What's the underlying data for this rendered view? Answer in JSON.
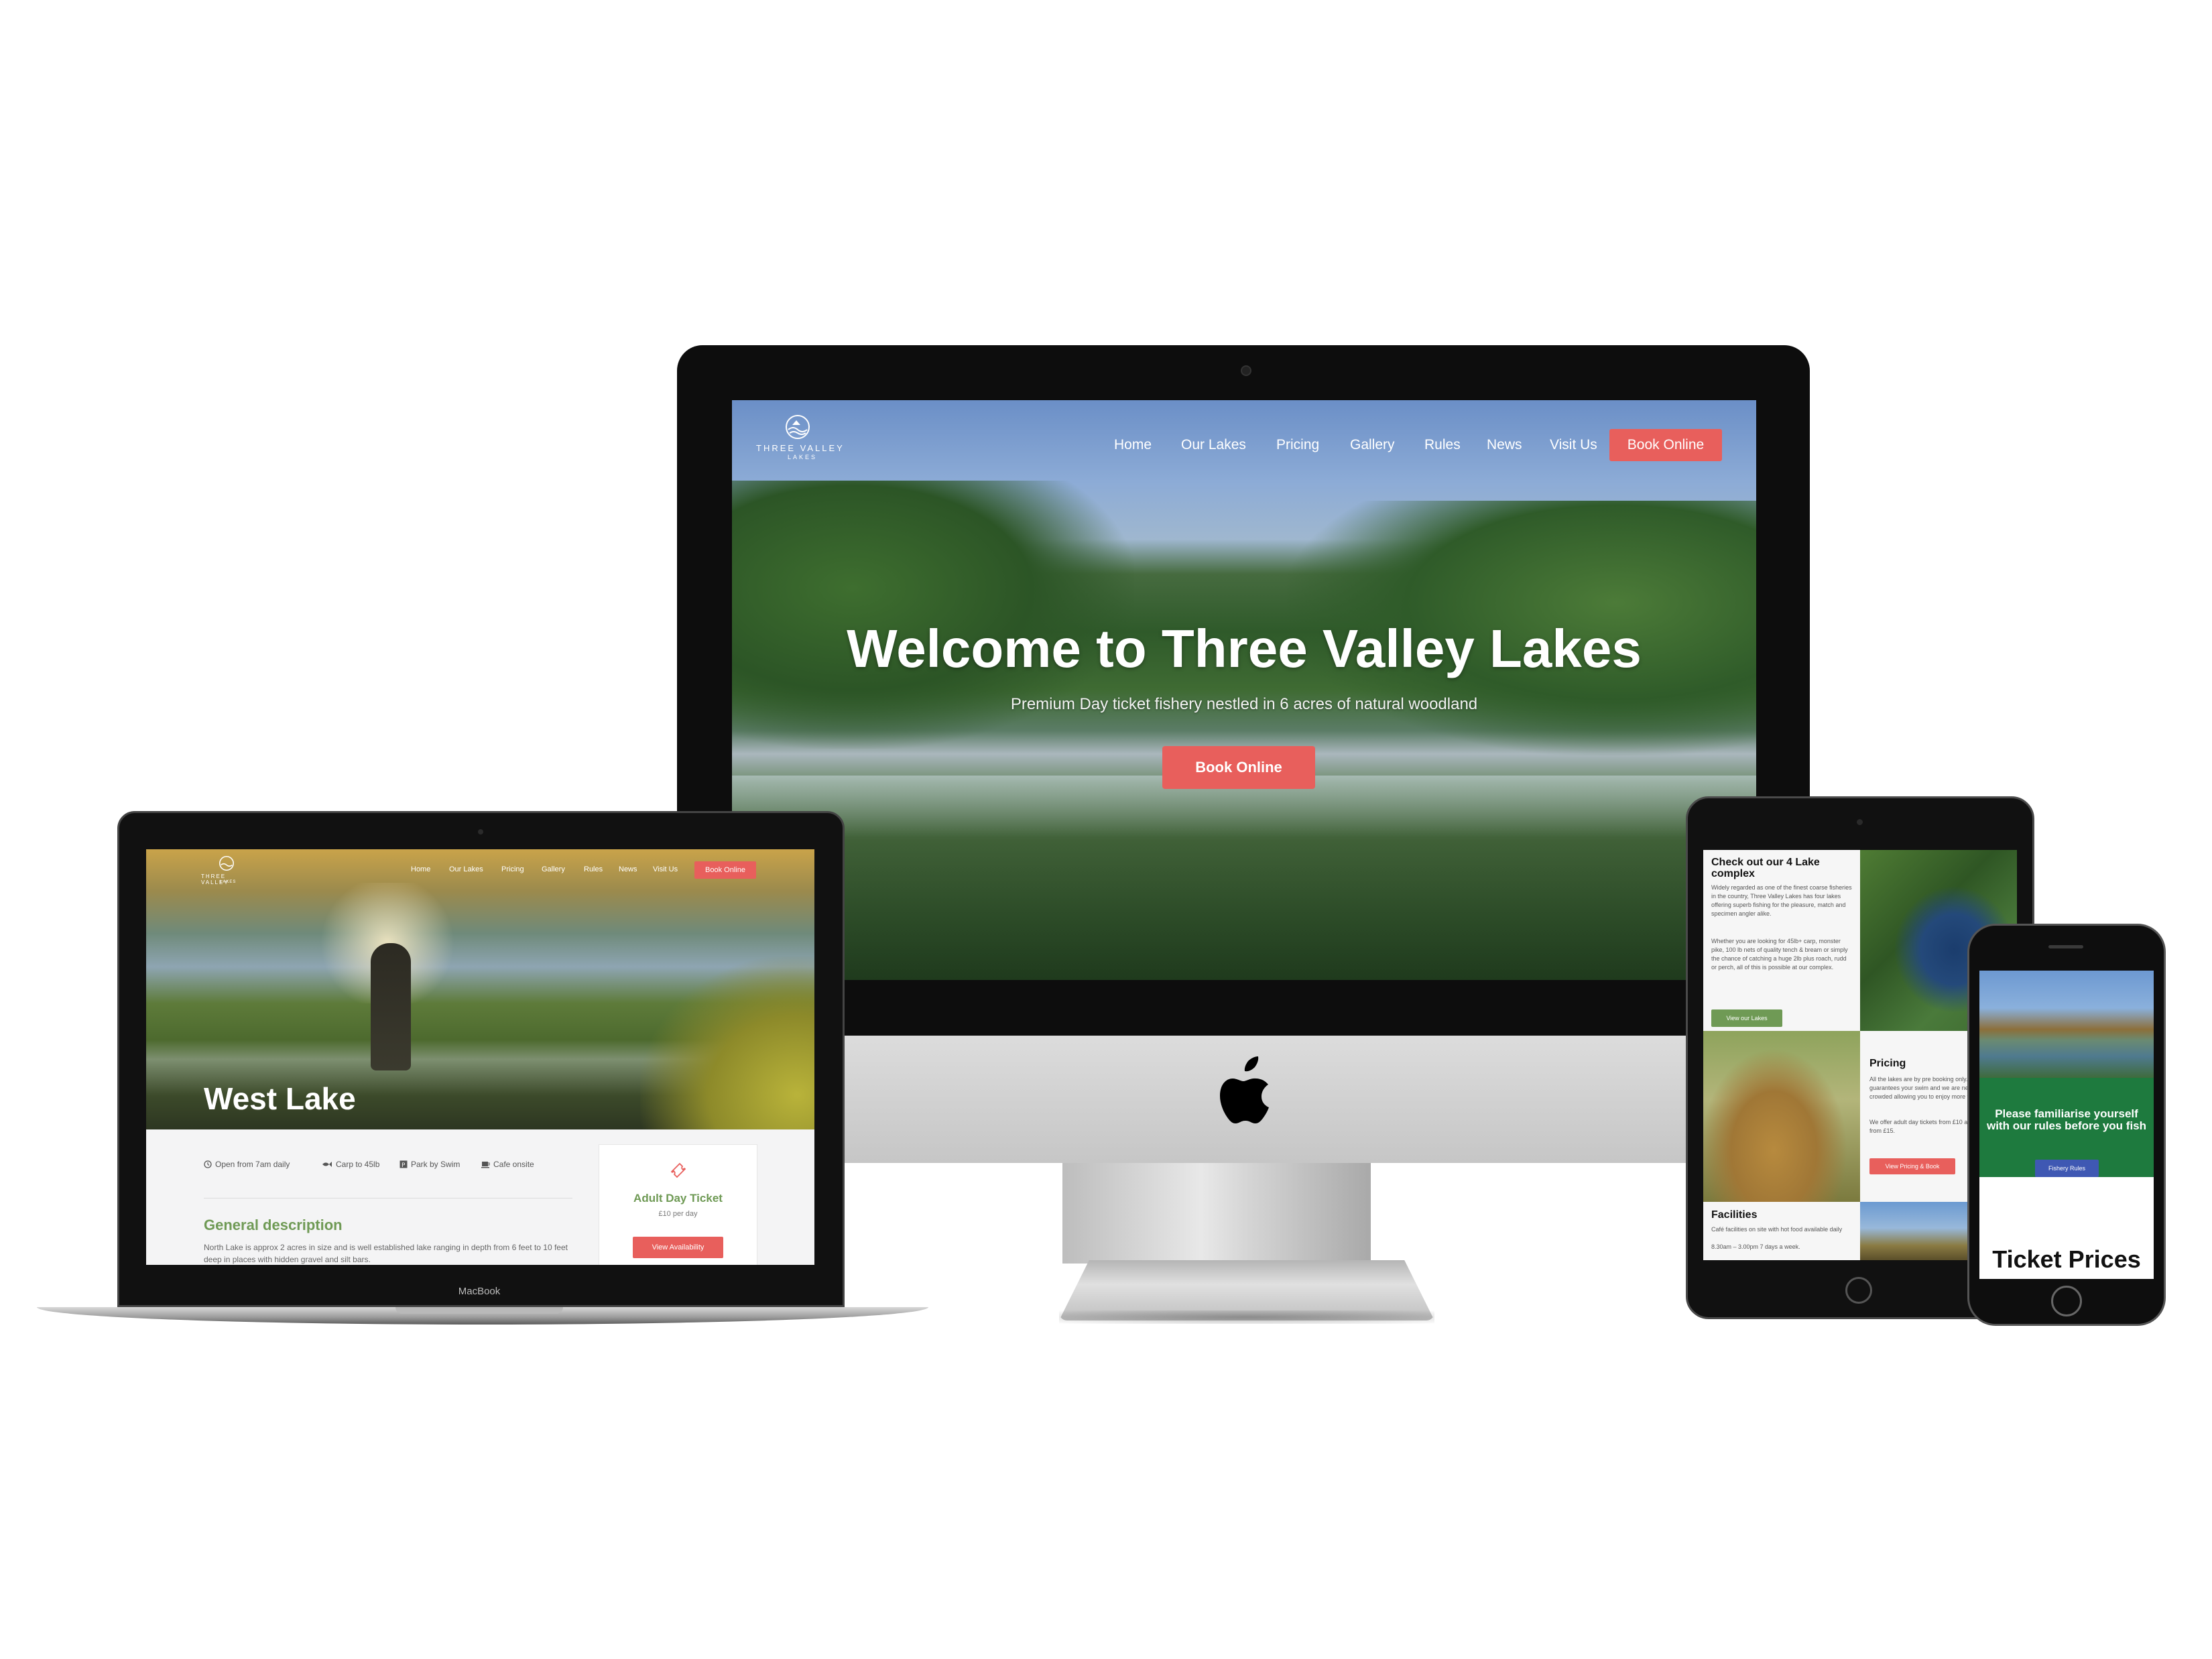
{
  "imac": {
    "brand": {
      "name": "THREE VALLEY",
      "sub": "LAKES"
    },
    "nav": [
      "Home",
      "Our Lakes",
      "Pricing",
      "Gallery",
      "Rules",
      "News",
      "Visit Us"
    ],
    "cta_label": "Book Online",
    "hero": {
      "title": "Welcome to Three Valley Lakes",
      "subtitle": "Premium Day ticket fishery nestled in 6 acres of natural woodland",
      "button": "Book Online"
    }
  },
  "macbook": {
    "brand": {
      "name": "THREE VALLEY",
      "sub": "LAKES"
    },
    "nav": [
      "Home",
      "Our Lakes",
      "Pricing",
      "Gallery",
      "Rules",
      "News",
      "Visit Us"
    ],
    "cta_label": "Book Online",
    "page_title": "West Lake",
    "meta": [
      "Open from 7am daily",
      "Carp to 45lb",
      "Park by Swim",
      "Cafe onsite"
    ],
    "section_title": "General description",
    "description": "North Lake is approx 2 acres in size and is well established lake ranging in depth from 6 feet to 10 feet deep in places with hidden gravel and silt bars.",
    "card": {
      "title": "Adult Day Ticket",
      "price": "£10 per day",
      "button": "View Availability"
    },
    "device_label": "MacBook"
  },
  "ipad": {
    "lakes": {
      "title": "Check out our 4 Lake complex",
      "p1": "Widely regarded as one of the finest coarse fisheries in the country, Three Valley Lakes has four lakes offering superb fishing for the pleasure, match and specimen angler alike.",
      "p2": "Whether you are looking for 45lb+ carp, monster pike, 100 lb nets of quality tench & bream or simply the chance of catching a huge 2lb plus roach, rudd or perch, all of this is possible at our complex.",
      "button": "View our Lakes"
    },
    "pricing": {
      "title": "Pricing",
      "p1": "All the lakes are by pre booking only. This guarantees your swim and we are never over crowded allowing you to enjoy more time fishing.",
      "p2": "We offer adult day tickets from £10 and 24hr tickets from £15.",
      "button": "View Pricing & Book"
    },
    "facilities": {
      "title": "Facilities",
      "p1": "Café facilities on site with hot food available daily",
      "p2": "8.30am – 3.00pm 7 days a week."
    }
  },
  "iphone": {
    "message": "Please familiarise yourself with our rules before you fish",
    "button": "Fishery Rules",
    "heading": "Ticket Prices"
  },
  "colors": {
    "accent": "#e85f5c",
    "green": "#6f9a55",
    "rules_bg": "#1e7a3e",
    "rules_btn": "#3f58b3"
  },
  "icons": [
    "apple-logo-icon",
    "clock-icon",
    "fish-icon",
    "parking-icon",
    "coffee-cup-icon",
    "ticket-icon",
    "lake-logo-icon"
  ]
}
